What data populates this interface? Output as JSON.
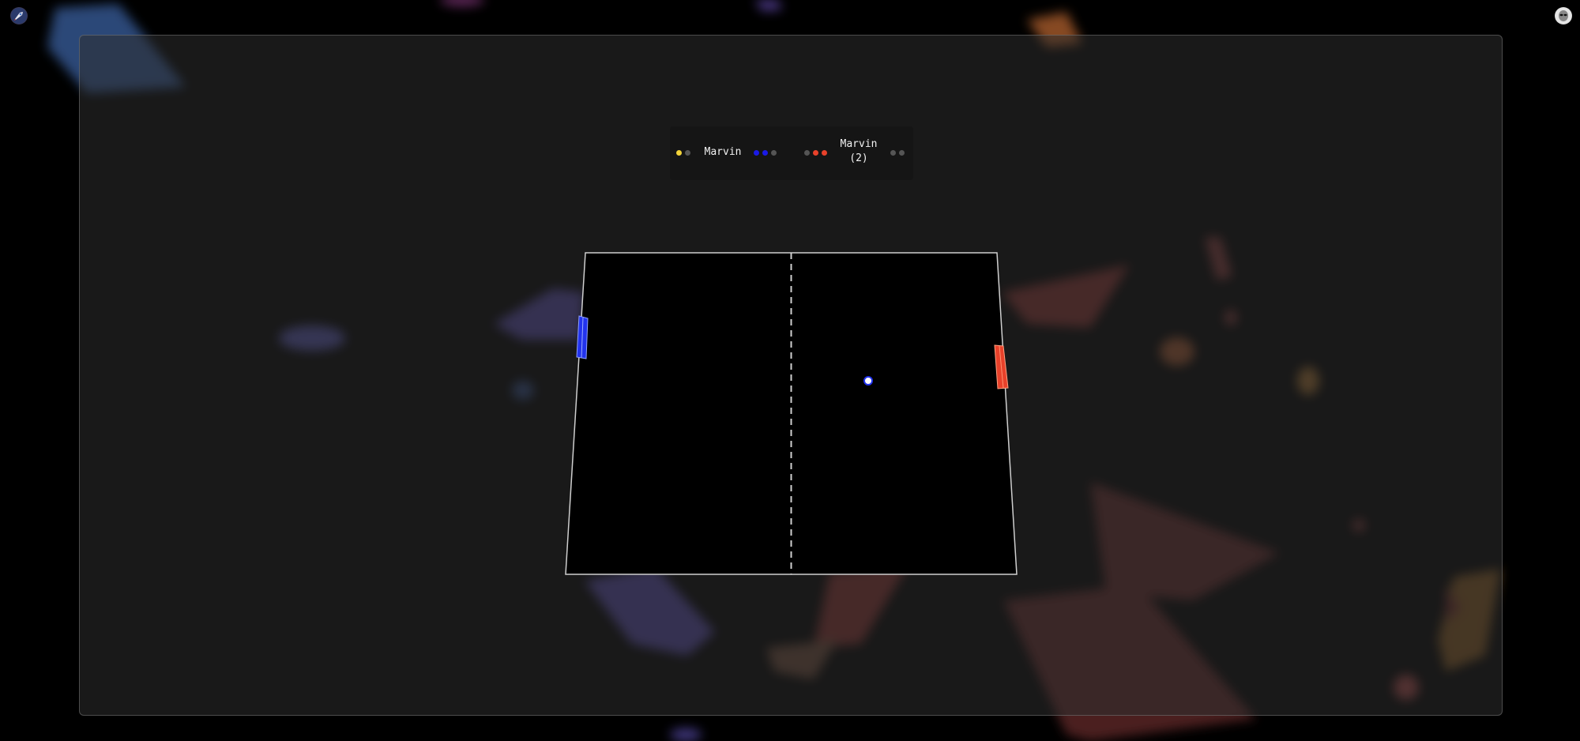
{
  "app": {
    "left_corner_icon": "rocket-avatar-icon",
    "right_corner_icon": "alien-icon"
  },
  "scoreboard": {
    "player1": {
      "name": "Marvin",
      "status_dots": [
        "#f2d33a",
        "#555555"
      ],
      "score_dots": [
        "#1a1ae6",
        "#1a1ae6",
        "#555555"
      ]
    },
    "player2": {
      "name_line1": "Marvin",
      "name_line2": "(2)",
      "score_dots": [
        "#555555",
        "#e8412a",
        "#e8412a"
      ],
      "status_dots": [
        "#555555",
        "#555555"
      ]
    }
  },
  "game": {
    "left_paddle_color": "#2233ee",
    "right_paddle_color": "#e8412a",
    "ball_color": "#ffffff",
    "ball_ring_color": "#2233ee"
  },
  "colors": {
    "background": "#000000",
    "court": "#000000",
    "court_border": "#cfcfcf",
    "frame_border": "#8c8c8c"
  }
}
